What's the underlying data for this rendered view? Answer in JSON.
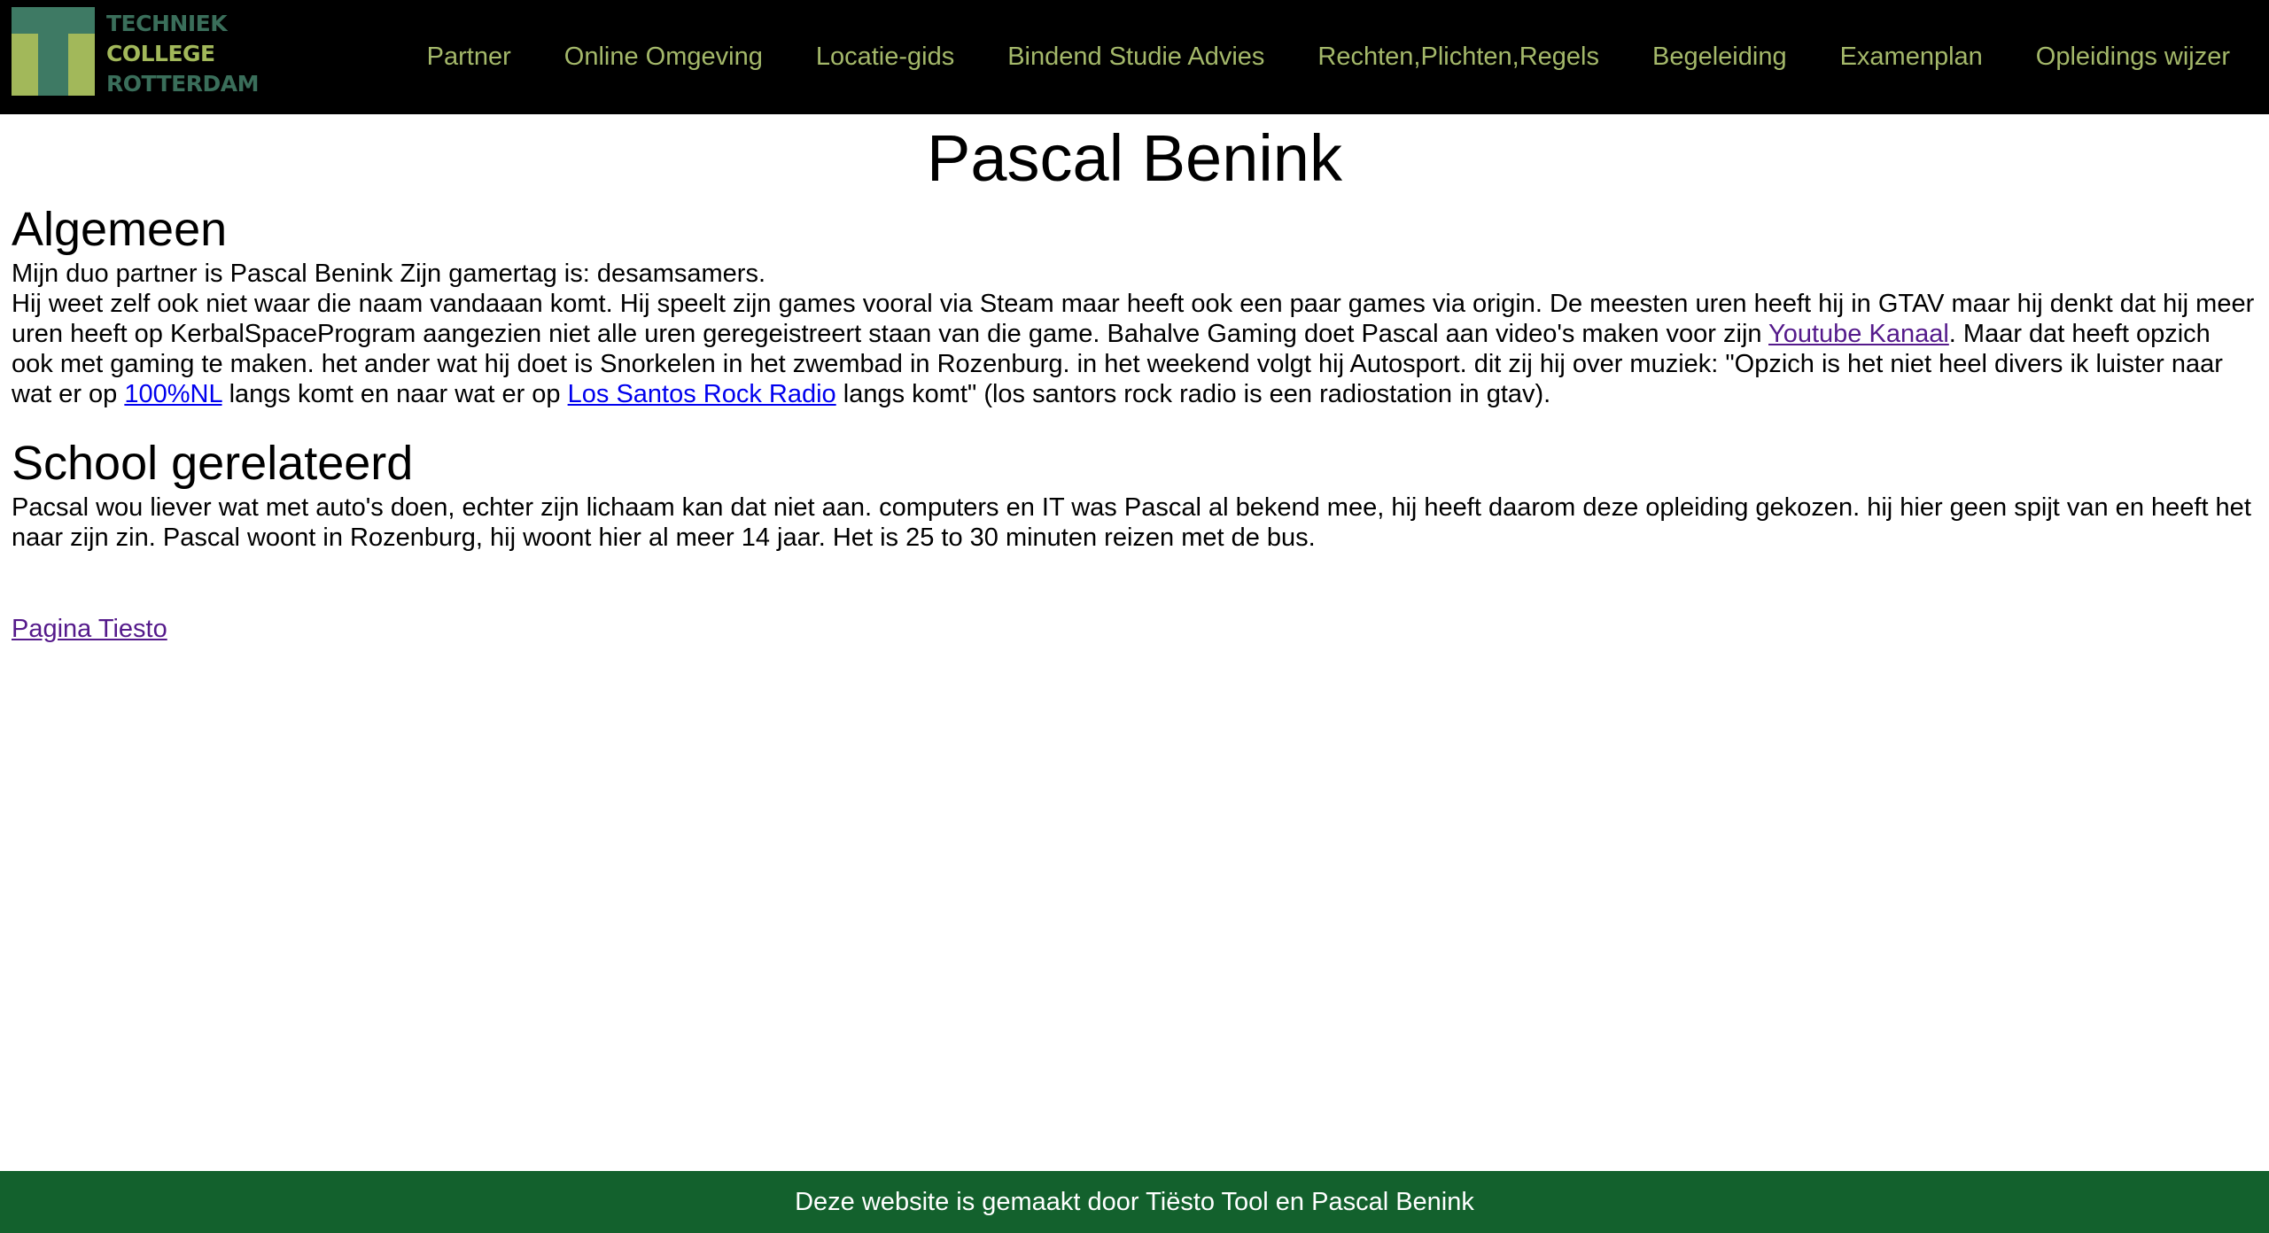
{
  "header": {
    "logo": {
      "line1": "TECHNIEK",
      "line2": "COLLEGE",
      "line3": "ROTTERDAM"
    },
    "nav": [
      "Partner",
      "Online Omgeving",
      "Locatie-gids",
      "Bindend Studie Advies",
      "Rechten,Plichten,Regels",
      "Begeleiding",
      "Examenplan",
      "Opleidings wijzer"
    ]
  },
  "main": {
    "title": "Pascal Benink",
    "section1": {
      "heading": "Algemeen",
      "line1": "Mijn duo partner is Pascal Benink Zijn gamertag is: desamsamers.",
      "text_a": "Hij weet zelf ook niet waar die naam vandaaan komt. Hij speelt zijn games vooral via Steam maar heeft ook een paar games via origin. De meesten uren heeft hij in GTAV maar hij denkt dat hij meer uren heeft op KerbalSpaceProgram aangezien niet alle uren geregeistreert staan van die game. Bahalve Gaming doet Pascal aan video's maken voor zijn ",
      "link_youtube": "Youtube Kanaal",
      "text_b": ". Maar dat heeft opzich ook met gaming te maken. het ander wat hij doet is Snorkelen in het zwembad in Rozenburg. in het weekend volgt hij Autosport. dit zij hij over muziek: \"Opzich is het niet heel divers ik luister naar wat er op ",
      "link_100nl": "100%NL",
      "text_c": " langs komt en naar wat er op ",
      "link_radio": "Los Santos Rock Radio",
      "text_d": " langs komt\" (los santors rock radio is een radiostation in gtav)."
    },
    "section2": {
      "heading": "School gerelateerd",
      "text": "Pacsal wou liever wat met auto's doen, echter zijn lichaam kan dat niet aan. computers en IT was Pascal al bekend mee, hij heeft daarom deze opleiding gekozen. hij hier geen spijt van en heeft het naar zijn zin. Pascal woont in Rozenburg, hij woont hier al meer 14 jaar. Het is 25 to 30 minuten reizen met de bus."
    },
    "page_link": "Pagina Tiesto"
  },
  "footer": {
    "text": "Deze website is gemaakt door Tiësto Tool en Pascal Benink"
  },
  "colors": {
    "header_bg": "#000000",
    "nav_text": "#a4b86a",
    "footer_bg": "#13612d",
    "link": "#0000ee",
    "visited_link": "#551a8b"
  }
}
